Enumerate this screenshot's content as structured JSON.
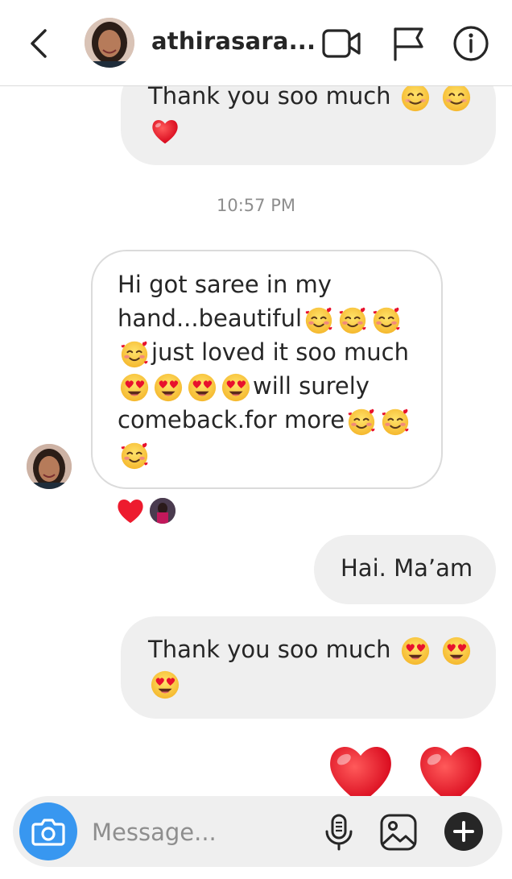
{
  "header": {
    "username": "athirasara...",
    "icons": [
      "back-icon",
      "video-call-icon",
      "flag-icon",
      "info-icon"
    ]
  },
  "messages": [
    {
      "id": "m0",
      "direction": "sent",
      "text_lines": [
        "Thank you soo much"
      ],
      "emojis": [
        "smiling-face",
        "smiling-face",
        "red-heart"
      ]
    },
    {
      "id": "ts",
      "type": "timestamp",
      "text": "10:57 PM"
    },
    {
      "id": "m1",
      "direction": "received",
      "lines": [
        "Hi got saree in my",
        "hand...beautiful",
        "just loved it soo much",
        "will surely",
        "comeback.for more"
      ],
      "reaction": "red-heart"
    },
    {
      "id": "m2",
      "direction": "sent",
      "text": "Hai. Ma’am"
    },
    {
      "id": "m3",
      "direction": "sent",
      "text": "Thank you soo much",
      "emojis": [
        "heart-eyes",
        "heart-eyes",
        "heart-eyes"
      ]
    },
    {
      "id": "m4",
      "direction": "sent",
      "emojis": [
        "red-heart",
        "red-heart"
      ]
    }
  ],
  "composer": {
    "placeholder": "Message...",
    "icons": [
      "camera-icon",
      "microphone-icon",
      "gallery-icon",
      "plus-icon"
    ]
  },
  "colors": {
    "sent_bubble": "#efefef",
    "received_border": "#dbdbdb",
    "camera_button": "#3897f0",
    "heart": "#ed1b2e"
  }
}
